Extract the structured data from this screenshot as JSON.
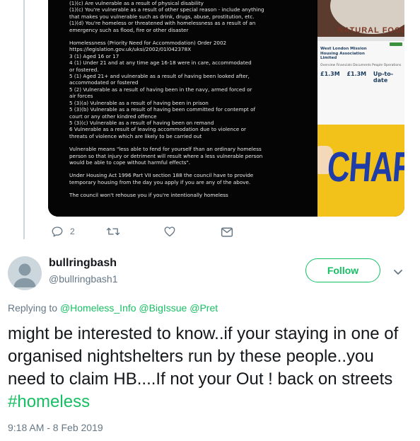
{
  "media": {
    "image_text_lines": [
      "(1)(c) Are vulnerable as a result of physical disability",
      "(1)(c) You're vulnerable as a result of other special reason - include anything",
      "that makes you vulnerable such as drink, drugs, abuse, prostitution, etc.",
      "(1)(d) You're homeless or threatened with homelessness as a result of an",
      "emergency such as flood, fire or other disaster",
      "",
      "Homelessness (Priority Need for Accommodation) Order 2002",
      "https://legislation.gov.uk/uksi/2002/01l042378X",
      "3 (1) Aged 16 or 17",
      "4 (1) Under 21 and at any time age 16-18 were in care, accommodated",
      "or fostered.",
      "5 (1) Aged 21+ and vulnerable as a result of having been looked after,",
      "accommodated or fostered",
      "5 (2) Vulnerable as a result of having been in the navy, armed forced or",
      "air forces",
      "5 (3)(a) Vulnerable as a result of having been in prison",
      "5 (3)(b) Vulnerable as a result of having been committed for contempt of",
      "court or any other kindred offence",
      "5 (3)(c) Vulnerable as a result of having been on remand",
      "6 Vulnerable as a result of leaving accommodation due to violence or",
      "threats of violence which are likely to be carried out",
      "",
      "Vulnerable means \"less able to fend for yourself than an ordinary homeless",
      "person so that injury or detriment will result where a less vulnerable person",
      "would be able to cope without harmful effects\".",
      "",
      "Under Housing Act 1996 Part VII section 188 the council have to provide",
      "temporary housing from the day you apply if you are any of the above.",
      "",
      "The council won't rehouse you if you're intentionally homeless"
    ],
    "badge_text": "NATURAL FOOD",
    "org_name": "West London Mission Housing Association Limited",
    "tabs_text": "Overview  Financials  Documents  People  Operations",
    "stats": [
      {
        "value": "£1.3M"
      },
      {
        "value": "£1.3M"
      },
      {
        "value": "Up-to-date"
      }
    ],
    "charity_text": "CHARIT"
  },
  "actions": {
    "reply_count": "2",
    "retweet_count": "",
    "like_count": ""
  },
  "user": {
    "display_name": "bullringbash",
    "handle": "@bullringbash1"
  },
  "follow_label": "Follow",
  "reply_prefix": "Replying to",
  "reply_mentions": [
    "@Homeless_Info",
    "@BigIssue",
    "@Pret"
  ],
  "tweet": {
    "text": "might be interested to know..if your staying in one of organised nightshelters run by these people..you need to claim HB....If not your Out ! back on streets ",
    "hashtag": "#homeless"
  },
  "timestamp": "9:18 AM - 8 Feb 2019",
  "colors": {
    "accent": "#17bf63",
    "muted": "#657786",
    "text": "#14171a"
  },
  "icons": [
    "reply-icon",
    "retweet-icon",
    "like-icon",
    "message-icon",
    "chevron-down-icon"
  ]
}
